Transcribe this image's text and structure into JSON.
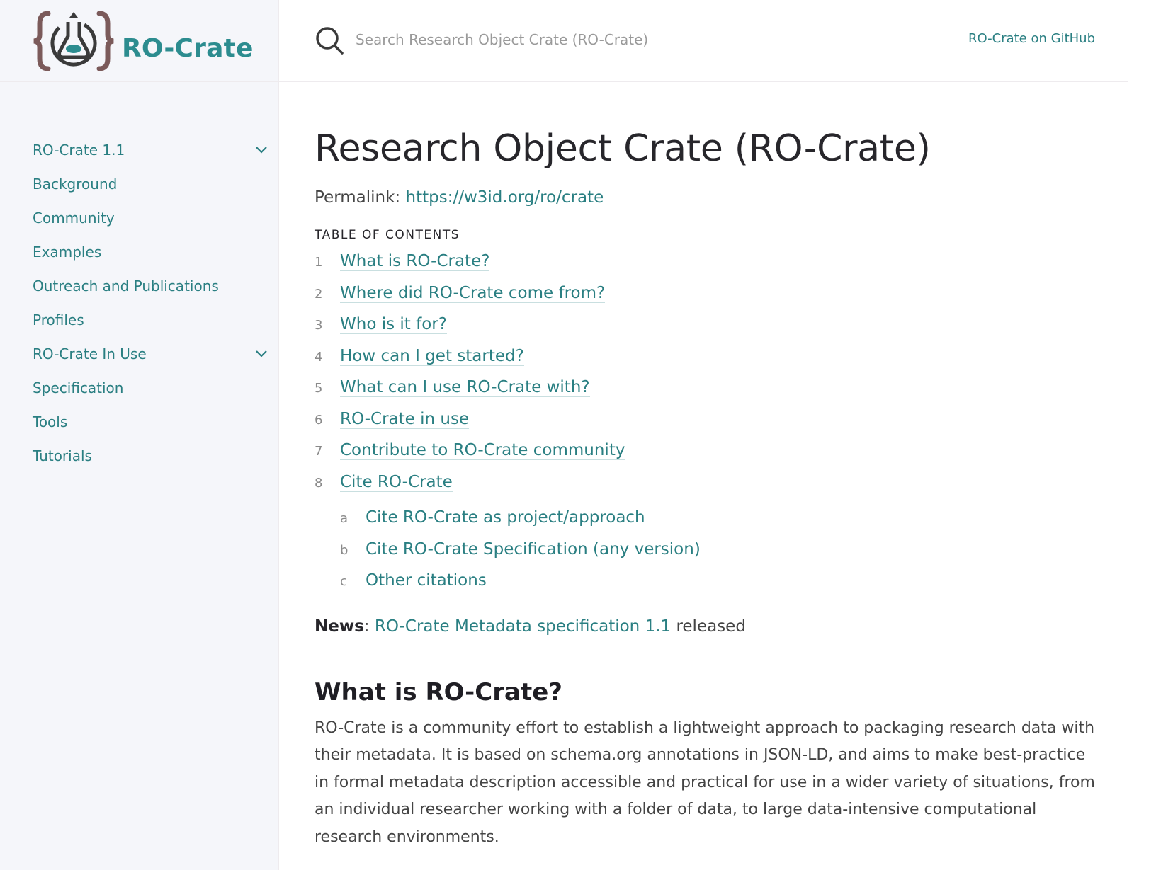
{
  "header": {
    "site_title": "RO-Crate",
    "logo_icon": "ro-crate-logo",
    "search_placeholder": "Search Research Object Crate (RO-Crate)",
    "github_link": "RO-Crate on GitHub",
    "accent_color": "#2a7f82"
  },
  "sidebar": {
    "items": [
      {
        "label": "RO-Crate 1.1",
        "expandable": true
      },
      {
        "label": "Background"
      },
      {
        "label": "Community"
      },
      {
        "label": "Examples"
      },
      {
        "label": "Outreach and Publications"
      },
      {
        "label": "Profiles"
      },
      {
        "label": "RO-Crate In Use",
        "expandable": true
      },
      {
        "label": "Specification"
      },
      {
        "label": "Tools"
      },
      {
        "label": "Tutorials"
      }
    ]
  },
  "main": {
    "title": "Research Object Crate (RO-Crate)",
    "permalink_label": "Permalink:",
    "permalink_url": "https://w3id.org/ro/crate",
    "toc_heading": "TABLE OF CONTENTS",
    "toc": [
      {
        "num": "1",
        "label": "What is RO-Crate?"
      },
      {
        "num": "2",
        "label": "Where did RO-Crate come from?"
      },
      {
        "num": "3",
        "label": "Who is it for?"
      },
      {
        "num": "4",
        "label": "How can I get started?"
      },
      {
        "num": "5",
        "label": "What can I use RO-Crate with?"
      },
      {
        "num": "6",
        "label": "RO-Crate in use"
      },
      {
        "num": "7",
        "label": "Contribute to RO-Crate community"
      },
      {
        "num": "8",
        "label": "Cite RO-Crate"
      }
    ],
    "subtoc": [
      {
        "num": "a",
        "label": "Cite RO-Crate as project/approach"
      },
      {
        "num": "b",
        "label": "Cite RO-Crate Specification (any version)"
      },
      {
        "num": "c",
        "label": "Other citations"
      }
    ],
    "news_label": "News",
    "news_sep": ": ",
    "news_link": "RO-Crate Metadata specification 1.1",
    "news_suffix": " released",
    "section_heading": "What is RO-Crate?",
    "section_text": "RO-Crate is a community effort to establish a lightweight approach to packaging research data with their metadata. It is based on schema.org annotations in JSON-LD, and aims to make best-practice in formal metadata description accessible and practical for use in a wider variety of situations, from an individual researcher working with a folder of data, to large data-intensive computational research environments."
  }
}
